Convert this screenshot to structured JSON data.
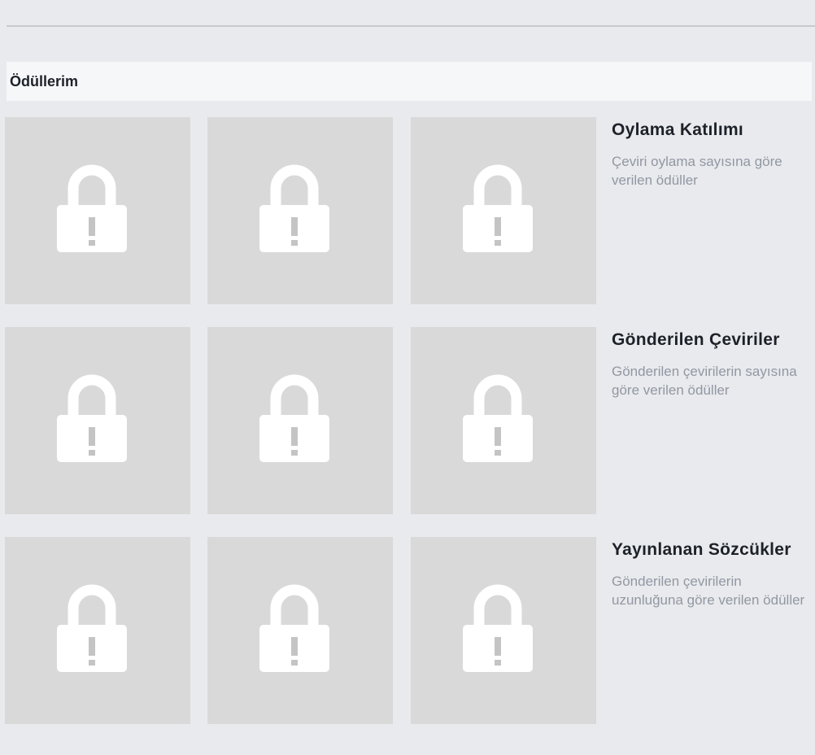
{
  "section": {
    "title": "Ödüllerim"
  },
  "awards": [
    {
      "title": "Oylama Katılımı",
      "description": "Çeviri oylama sayısına göre verilen ödüller",
      "tiles": [
        "locked",
        "locked",
        "locked"
      ]
    },
    {
      "title": "Gönderilen Çeviriler",
      "description": "Gönderilen çevirilerin sayısına göre verilen ödüller",
      "tiles": [
        "locked",
        "locked",
        "locked"
      ]
    },
    {
      "title": "Yayınlanan Sözcükler",
      "description": "Gönderilen çevirilerin uzunluğuna göre verilen ödüller",
      "tiles": [
        "locked",
        "locked",
        "locked"
      ]
    }
  ],
  "icons": {
    "tile": "padlock-exclamation-icon"
  },
  "colors": {
    "background": "#e9eaed",
    "tile": "#d9d9d9",
    "lock": "#ffffff",
    "lock_mark": "#c4c4c4",
    "title_text": "#1d2129",
    "description_text": "#9197a3"
  }
}
